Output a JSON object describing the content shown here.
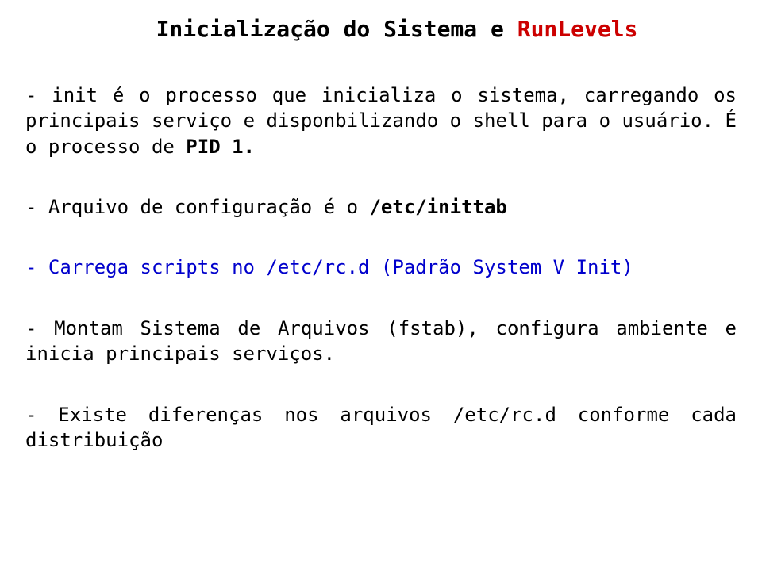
{
  "title": {
    "prefix": "Inicialização do Sistema e ",
    "highlight": "RunLevels"
  },
  "paragraphs": {
    "p1_pre": "- init é o processo que inicializa o sistema, carregando os principais serviço e disponbilizando o shell para o usuário. É o processo de ",
    "p1_bold": "PID 1.",
    "p2_pre": "- Arquivo de configuração é o ",
    "p2_bold": "/etc/inittab",
    "p3": "- Carrega scripts no /etc/rc.d (Padrão System V Init)",
    "p4": "- Montam Sistema de Arquivos (fstab), configura ambiente e inicia principais serviços.",
    "p5": "- Existe diferenças nos arquivos /etc/rc.d conforme cada distribuição"
  }
}
